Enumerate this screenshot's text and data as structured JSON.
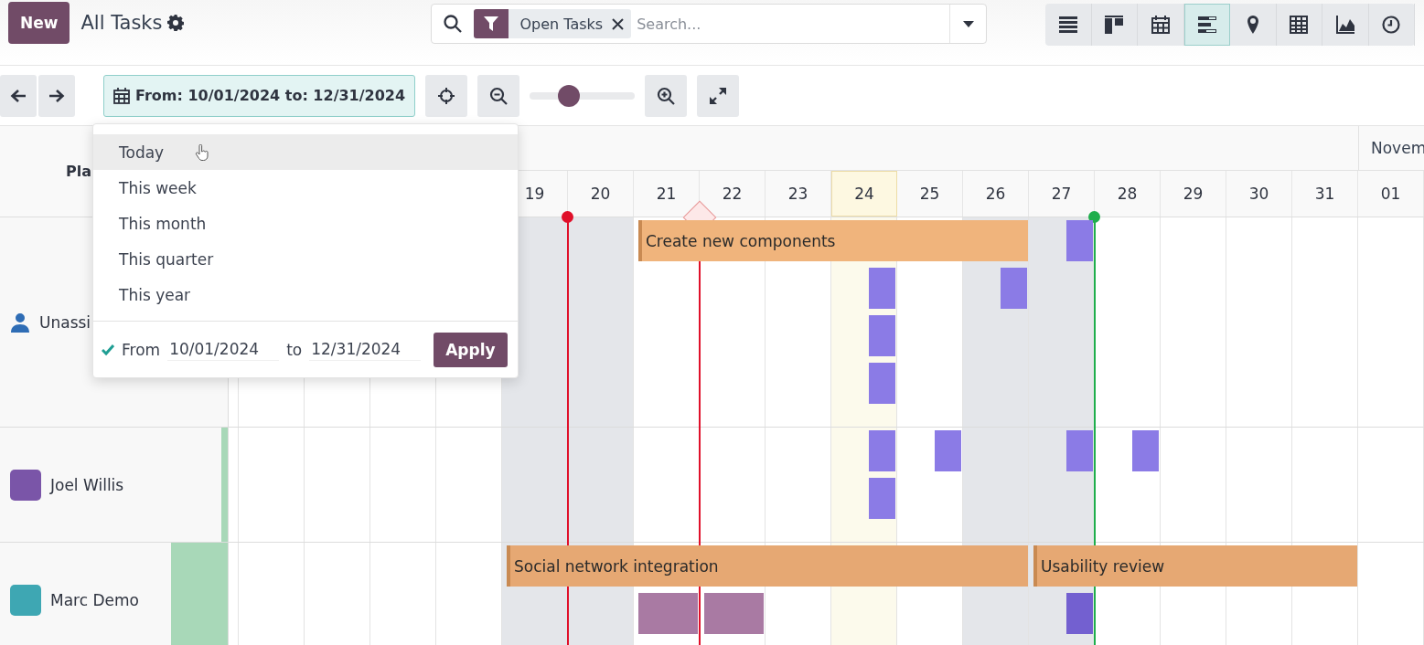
{
  "header": {
    "new_button": "New",
    "title": "All Tasks"
  },
  "search": {
    "facet": "Open Tasks",
    "placeholder": "Search..."
  },
  "views": [
    {
      "kind": "list",
      "selected": false
    },
    {
      "kind": "kanban",
      "selected": false
    },
    {
      "kind": "calendar",
      "selected": false
    },
    {
      "kind": "gantt",
      "selected": true
    },
    {
      "kind": "map",
      "selected": false
    },
    {
      "kind": "pivot",
      "selected": false
    },
    {
      "kind": "graph",
      "selected": false
    },
    {
      "kind": "activity",
      "selected": false
    }
  ],
  "toolbar": {
    "date_range": "From: 10/01/2024 to: 12/31/2024",
    "zoom": {
      "level": 0.37
    }
  },
  "date_menu": {
    "items": [
      {
        "label": "Today",
        "hovered": true
      },
      {
        "label": "This week",
        "hovered": false
      },
      {
        "label": "This month",
        "hovered": false
      },
      {
        "label": "This quarter",
        "hovered": false
      },
      {
        "label": "This year",
        "hovered": false
      }
    ],
    "custom": {
      "checked": true,
      "from_label": "From",
      "from": "10/01/2024",
      "to_label": "to",
      "to": "12/31/2024",
      "apply": "Apply"
    }
  },
  "gantt": {
    "row_header": "Pla",
    "days": [
      {
        "weekend": false,
        "today": false
      },
      {
        "weekend": false,
        "today": false
      },
      {
        "weekend": false,
        "today": false
      },
      {
        "weekend": false,
        "today": false
      },
      {
        "label": "19",
        "weekend": true,
        "today": false
      },
      {
        "label": "20",
        "weekend": true,
        "today": false,
        "marker": {
          "kind": "dot",
          "color": "#e0102a"
        }
      },
      {
        "label": "21",
        "weekend": false,
        "today": false
      },
      {
        "label": "22",
        "weekend": false,
        "today": false,
        "marker": {
          "kind": "diamond",
          "color": "#e0102a"
        }
      },
      {
        "label": "23",
        "weekend": false,
        "today": false
      },
      {
        "label": "24",
        "weekend": false,
        "today": true
      },
      {
        "label": "25",
        "weekend": false,
        "today": false
      },
      {
        "label": "26",
        "weekend": true,
        "today": false
      },
      {
        "label": "27",
        "weekend": true,
        "today": false
      },
      {
        "label": "28",
        "weekend": false,
        "today": false,
        "marker": {
          "kind": "dot",
          "color": "#1fae4c"
        }
      },
      {
        "label": "29",
        "weekend": false,
        "today": false
      },
      {
        "label": "30",
        "weekend": false,
        "today": false
      },
      {
        "label": "31",
        "weekend": false,
        "today": false
      },
      {
        "label": "01",
        "weekend": false,
        "today": false,
        "month": "Novem"
      }
    ],
    "rows": [
      {
        "name": "Unassi",
        "kind": "unassigned",
        "lanes": [
          {
            "slots": [
              {
                "kind": "gap"
              },
              {
                "kind": "gap"
              },
              {
                "kind": "gap"
              },
              {
                "kind": "gap"
              },
              {
                "kind": "gap"
              },
              {
                "kind": "gap"
              },
              {
                "kind": "bar",
                "label": "Create new components",
                "color": "#f0b47c"
              },
              {
                "kind": "more"
              },
              {
                "kind": "more"
              },
              {
                "kind": "more"
              },
              {
                "kind": "more"
              },
              {
                "kind": "more"
              },
              {
                "kind": "half",
                "color": "#8b7be6"
              }
            ]
          },
          {
            "slots": [
              {
                "kind": "gap"
              },
              {
                "kind": "gap"
              },
              {
                "kind": "gap"
              },
              {
                "kind": "gap"
              },
              {
                "kind": "gap"
              },
              {
                "kind": "gap"
              },
              {
                "kind": "gap"
              },
              {
                "kind": "gap"
              },
              {
                "kind": "gap"
              },
              {
                "kind": "half",
                "color": "#8b7be6"
              },
              {
                "kind": "gap"
              },
              {
                "kind": "half",
                "color": "#8b7be6"
              }
            ]
          },
          {
            "slots": [
              {
                "kind": "gap"
              },
              {
                "kind": "gap"
              },
              {
                "kind": "gap"
              },
              {
                "kind": "gap"
              },
              {
                "kind": "gap"
              },
              {
                "kind": "gap"
              },
              {
                "kind": "gap"
              },
              {
                "kind": "gap"
              },
              {
                "kind": "gap"
              },
              {
                "kind": "half",
                "color": "#8b7be6"
              }
            ]
          },
          {
            "slots": [
              {
                "kind": "gap"
              },
              {
                "kind": "gap"
              },
              {
                "kind": "gap"
              },
              {
                "kind": "gap"
              },
              {
                "kind": "gap"
              },
              {
                "kind": "gap"
              },
              {
                "kind": "gap"
              },
              {
                "kind": "gap"
              },
              {
                "kind": "gap"
              },
              {
                "kind": "half",
                "color": "#8b7be6"
              }
            ]
          }
        ]
      },
      {
        "name": "Joel Willis",
        "kind": "user",
        "level": 0.03,
        "lanes": [
          {
            "slots": [
              {
                "kind": "gap"
              },
              {
                "kind": "gap"
              },
              {
                "kind": "gap"
              },
              {
                "kind": "gap"
              },
              {
                "kind": "gap"
              },
              {
                "kind": "gap"
              },
              {
                "kind": "gap"
              },
              {
                "kind": "gap"
              },
              {
                "kind": "gap"
              },
              {
                "kind": "half",
                "color": "#8b7be6"
              },
              {
                "kind": "half",
                "color": "#8b7be6"
              },
              {
                "kind": "gap"
              },
              {
                "kind": "half",
                "color": "#8b7be6"
              },
              {
                "kind": "half",
                "color": "#8b7be6"
              }
            ]
          },
          {
            "slots": [
              {
                "kind": "gap"
              },
              {
                "kind": "gap"
              },
              {
                "kind": "gap"
              },
              {
                "kind": "gap"
              },
              {
                "kind": "gap"
              },
              {
                "kind": "gap"
              },
              {
                "kind": "gap"
              },
              {
                "kind": "gap"
              },
              {
                "kind": "gap"
              },
              {
                "kind": "half",
                "color": "#8b7be6"
              }
            ]
          }
        ]
      },
      {
        "name": "Marc Demo",
        "kind": "user",
        "level": 0.25,
        "lanes": [
          {
            "slots": [
              {
                "kind": "gap"
              },
              {
                "kind": "gap"
              },
              {
                "kind": "gap"
              },
              {
                "kind": "gap"
              },
              {
                "kind": "bar",
                "label": "Social network integration",
                "color": "#e6a873"
              },
              {
                "kind": "more"
              },
              {
                "kind": "more"
              },
              {
                "kind": "more"
              },
              {
                "kind": "more"
              },
              {
                "kind": "more"
              },
              {
                "kind": "more"
              },
              {
                "kind": "more"
              },
              {
                "kind": "bar",
                "label": "Usability review",
                "color": "#e6a873"
              },
              {
                "kind": "more"
              },
              {
                "kind": "more"
              },
              {
                "kind": "more"
              },
              {
                "kind": "more"
              }
            ]
          },
          {
            "slots": [
              {
                "kind": "gap"
              },
              {
                "kind": "gap"
              },
              {
                "kind": "gap"
              },
              {
                "kind": "gap"
              },
              {
                "kind": "gap"
              },
              {
                "kind": "gap"
              },
              {
                "kind": "block",
                "color": "#a97aa3"
              },
              {
                "kind": "block",
                "color": "#a97aa3"
              },
              {
                "kind": "gap"
              },
              {
                "kind": "gap"
              },
              {
                "kind": "gap"
              },
              {
                "kind": "gap"
              },
              {
                "kind": "half",
                "color": "#7360d0"
              }
            ]
          }
        ]
      }
    ]
  }
}
